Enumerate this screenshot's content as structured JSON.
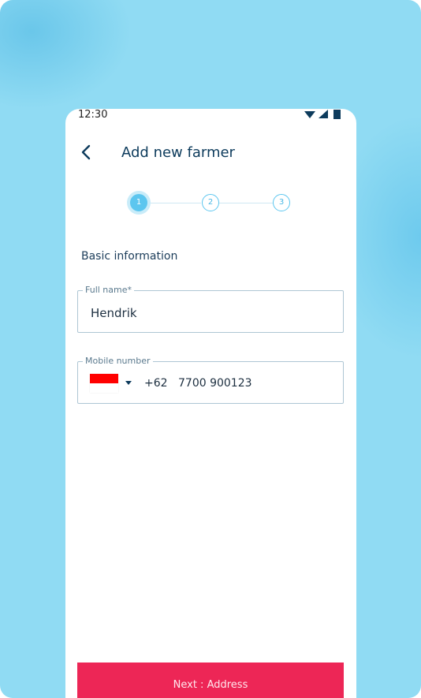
{
  "status_bar": {
    "time": "12:30"
  },
  "header": {
    "title": "Add new farmer",
    "back_icon": "chevron-left-icon"
  },
  "stepper": {
    "steps": [
      {
        "label": "1",
        "state": "active"
      },
      {
        "label": "2",
        "state": "idle"
      },
      {
        "label": "3",
        "state": "idle"
      }
    ]
  },
  "section_title": "Basic information",
  "full_name": {
    "label": "Full name*",
    "value": "Hendrik"
  },
  "mobile": {
    "label": "Mobile number",
    "country_flag": "indonesia-flag-icon",
    "prefix": "+62",
    "value": "7700 900123"
  },
  "next_button": {
    "label": "Next : Address"
  },
  "colors": {
    "primary_text": "#0d3b5c",
    "accent": "#5cc6ef",
    "button": "#ed2656",
    "background": "#90dbf3"
  }
}
